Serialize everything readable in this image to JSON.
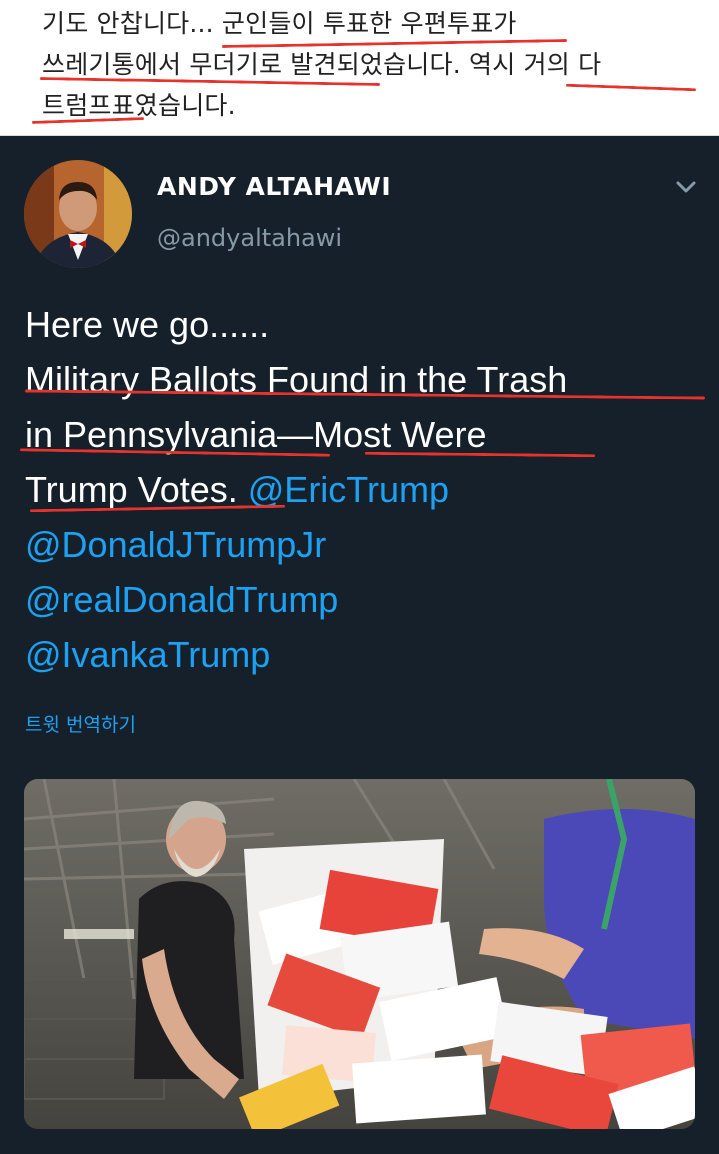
{
  "caption": {
    "line1": "기도 안찹니다... 군인들이 투표한 우편투표가",
    "line2": "쓰레기통에서 무더기로 발견되었습니다. 역시 거의 다",
    "line3": "트럼프표였습니다."
  },
  "tweet": {
    "display_name": "ANDY ALTAHAWI",
    "handle": "@andyaltahawi",
    "lines": [
      "Here we go......",
      "Military Ballots Found in the Trash",
      "in Pennsylvania—Most Were"
    ],
    "line4_text": "Trump Votes.",
    "mentions": [
      "@EricTrump",
      "@DonaldJTrumpJr",
      "@realDonaldTrump",
      "@IvankaTrump"
    ],
    "translate_label": "트윗 번역하기"
  },
  "colors": {
    "background": "#15202b",
    "link": "#1da1f2",
    "secondary_text": "#8899a6",
    "annotation_red": "#e8322c"
  },
  "icons": {
    "menu": "chevron-down-icon"
  }
}
